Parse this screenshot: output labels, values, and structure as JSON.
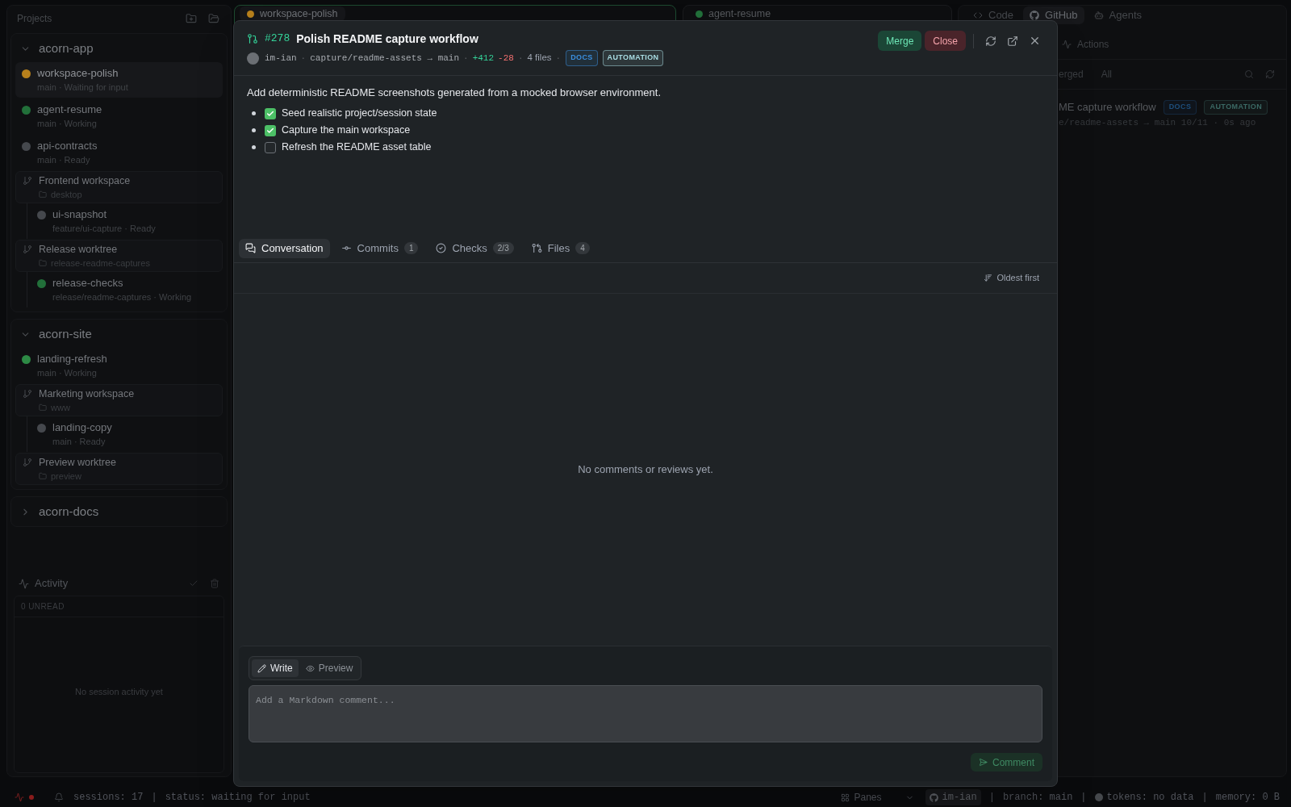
{
  "sidebar": {
    "title": "Projects",
    "projects": [
      {
        "name": "acorn-app",
        "expanded": true,
        "items": [
          {
            "kind": "session",
            "name": "workspace-polish",
            "detail": "main · Waiting for input",
            "color": "#b7801c",
            "selected": true
          },
          {
            "kind": "session",
            "name": "agent-resume",
            "detail": "main · Working",
            "color": "#22703a",
            "selected": false
          },
          {
            "kind": "session",
            "name": "api-contracts",
            "detail": "main · Ready",
            "color": "#45484d",
            "selected": false
          },
          {
            "kind": "worktree",
            "name": "Frontend workspace",
            "folder": "desktop",
            "children": [
              {
                "kind": "session",
                "name": "ui-snapshot",
                "detail": "feature/ui-capture · Ready",
                "color": "#45484d",
                "selected": false
              }
            ]
          },
          {
            "kind": "worktree",
            "name": "Release worktree",
            "folder": "release-readme-captures",
            "children": [
              {
                "kind": "session",
                "name": "release-checks",
                "detail": "release/readme-captures · Working",
                "color": "#22703a",
                "selected": false
              }
            ]
          }
        ]
      },
      {
        "name": "acorn-site",
        "expanded": true,
        "items": [
          {
            "kind": "session",
            "name": "landing-refresh",
            "detail": "main · Working",
            "color": "#2d8a45",
            "selected": false
          },
          {
            "kind": "worktree",
            "name": "Marketing workspace",
            "folder": "www",
            "children": [
              {
                "kind": "session",
                "name": "landing-copy",
                "detail": "main · Ready",
                "color": "#45484d",
                "selected": false
              }
            ]
          },
          {
            "kind": "worktree",
            "name": "Preview worktree",
            "folder": "preview"
          }
        ]
      },
      {
        "name": "acorn-docs",
        "expanded": false
      }
    ]
  },
  "activity": {
    "title": "Activity",
    "unread": "0 UNREAD",
    "empty": "No session activity yet"
  },
  "pane_tabs": [
    {
      "label": "workspace-polish",
      "color": "#b7801c",
      "selected": true
    },
    {
      "label": "agent-resume",
      "color": "#22703a",
      "selected": false
    }
  ],
  "right_panel": {
    "tabs": [
      {
        "label": "Code",
        "selected": false
      },
      {
        "label": "GitHub",
        "selected": true
      },
      {
        "label": "Agents",
        "selected": false
      }
    ],
    "section": "Actions",
    "filters": [
      "erged",
      "All"
    ],
    "pr": {
      "title": "ME capture workflow",
      "labels": [
        {
          "text": "DOCS",
          "color": "#1e4f7d"
        },
        {
          "text": "AUTOMATION",
          "color": "#3b6964"
        }
      ],
      "meta": "e/readme-assets → main 10/11 · 0s ago"
    }
  },
  "modal": {
    "number": "#278",
    "title": "Polish README capture workflow",
    "author": "im-ian",
    "separator": "·",
    "branch": "capture/readme-assets → main",
    "additions": "+412",
    "deletions": "-28",
    "files": "4 files",
    "labels": [
      {
        "text": "DOCS",
        "color": "#3b8ede"
      },
      {
        "text": "AUTOMATION",
        "color": "#a9dde3"
      }
    ],
    "actions": [
      {
        "label": "Merge",
        "kind": "merge"
      },
      {
        "label": "Close",
        "kind": "close"
      }
    ],
    "description": "Add deterministic README screenshots generated from a mocked browser environment.",
    "tasks": [
      {
        "text": "Seed realistic project/session state",
        "checked": true
      },
      {
        "text": "Capture the main workspace",
        "checked": true
      },
      {
        "text": "Refresh the README asset table",
        "checked": false
      }
    ],
    "tabs": [
      {
        "label": "Conversation",
        "selected": true
      },
      {
        "label": "Commits",
        "count": "1",
        "selected": false
      },
      {
        "label": "Checks",
        "count": "2/3",
        "selected": false
      },
      {
        "label": "Files",
        "count": "4",
        "selected": false
      }
    ],
    "sort": "Oldest first",
    "empty": "No comments or reviews yet.",
    "composer": {
      "tabs": [
        {
          "label": "Write",
          "selected": true
        },
        {
          "label": "Preview",
          "selected": false
        }
      ],
      "placeholder": "Add a Markdown comment...",
      "submit": {
        "label": "Comment",
        "disabled": true
      }
    }
  },
  "status_bar": {
    "separator": "|",
    "sessions": "sessions: 17",
    "status": "status: waiting for input",
    "panes": "Panes",
    "user": "im-ian",
    "branch": "branch: main",
    "tokens": "tokens: no data",
    "memory": "memory: 0 B"
  }
}
